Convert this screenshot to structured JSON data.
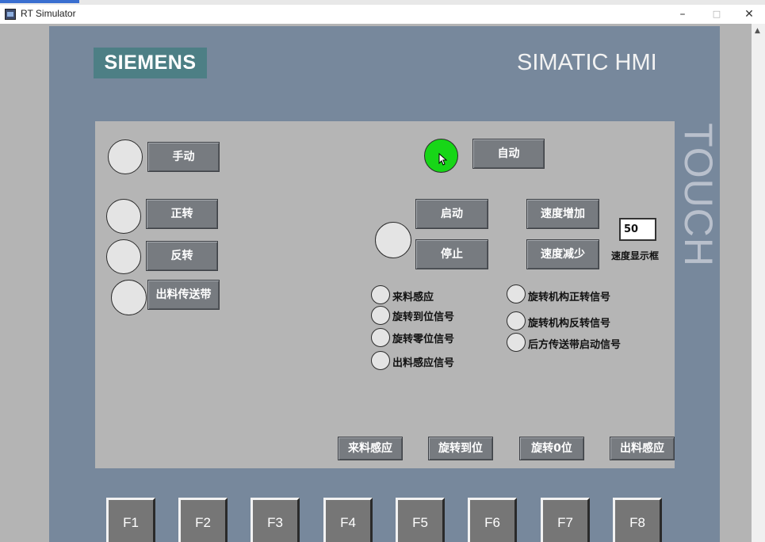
{
  "window": {
    "title": "RT Simulator",
    "minimize": "–",
    "maximize": "□",
    "close": "✕"
  },
  "device": {
    "brand": "SIEMENS",
    "model": "SIMATIC HMI",
    "side_label": "TOUCH"
  },
  "colors": {
    "lamp_off": "#e4e4e4",
    "lamp_on": "#17d617",
    "button": "#777b80",
    "panel": "#77889c",
    "screen": "#b5b5b5",
    "brand_bg": "#4d7f85"
  },
  "mode_controls": {
    "manual": "手动",
    "auto": "自动",
    "auto_lamp": "on",
    "manual_lamp": "off"
  },
  "manual_buttons": {
    "forward": "正转",
    "reverse": "反转",
    "outfeed_conveyor": "出料传送带"
  },
  "run_controls": {
    "start": "启动",
    "stop": "停止"
  },
  "speed": {
    "increase": "速度增加",
    "decrease": "速度减少",
    "value": "50",
    "display_label": "速度显示框"
  },
  "signals_left": [
    "来料感应",
    "旋转到位信号",
    "旋转零位信号",
    "出料感应信号"
  ],
  "signals_right": [
    "旋转机构正转信号",
    "旋转机构反转信号",
    "后方传送带启动信号"
  ],
  "sim_buttons": {
    "infeed_sense": "来料感应",
    "rotate_in_position": "旋转到位",
    "rotate_zero": "旋转0位",
    "outfeed_sense": "出料感应"
  },
  "function_keys": [
    "F1",
    "F2",
    "F3",
    "F4",
    "F5",
    "F6",
    "F7",
    "F8"
  ]
}
